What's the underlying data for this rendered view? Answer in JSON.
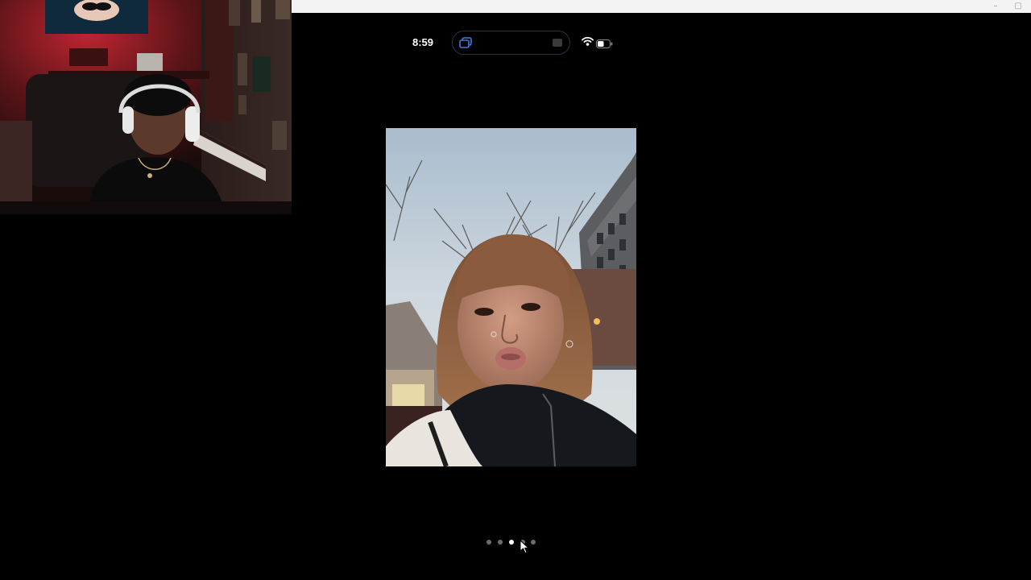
{
  "status_bar": {
    "time": "8:59",
    "icons": [
      "screen-mirroring-icon",
      "camera-indicator-icon",
      "wifi-icon",
      "battery-icon"
    ]
  },
  "window_controls": {
    "minimize": "–",
    "restore": "▢"
  },
  "photo_viewer": {
    "page_count": 5,
    "current_page": 3
  },
  "colors": {
    "background": "#000000",
    "dot_active": "#ffffff",
    "dot_inactive": "#6d6d6d",
    "window_bar": "#f3f3f3"
  }
}
